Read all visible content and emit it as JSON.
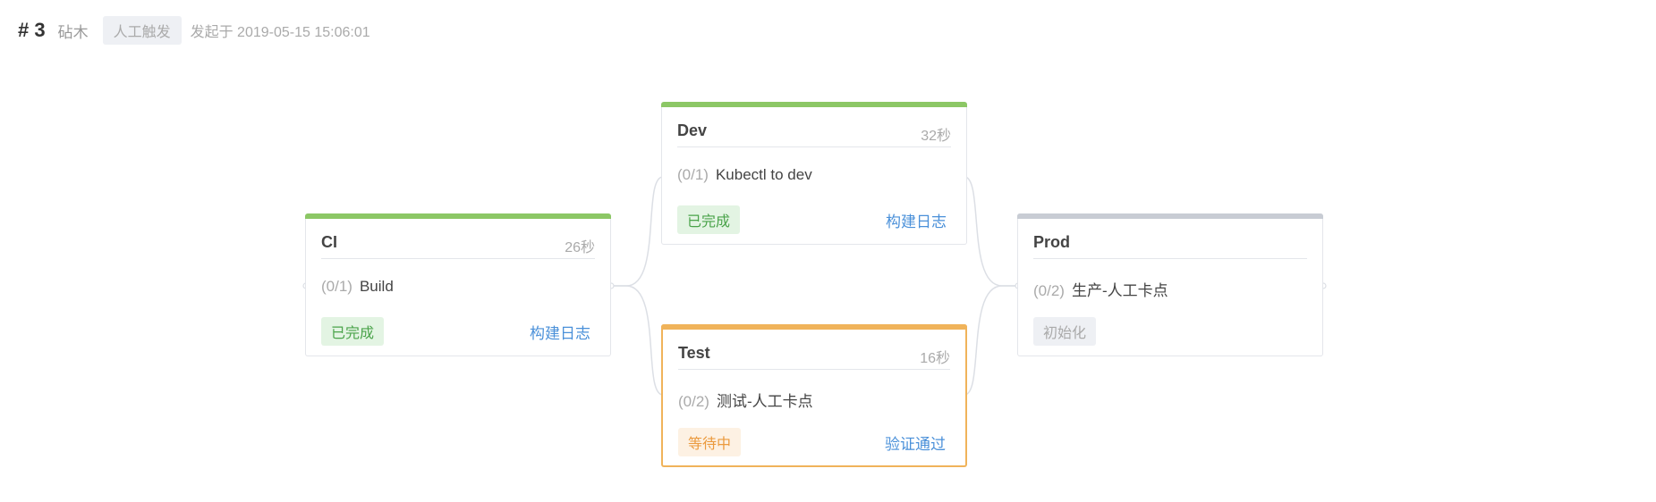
{
  "header": {
    "run_number": "# 3",
    "author": "砧木",
    "trigger_badge": "人工触发",
    "started": "发起于 2019-05-15 15:06:01"
  },
  "colors": {
    "success": "#8cc765",
    "waiting": "#f0b35a",
    "pending": "#c8ccd4",
    "link": "#4a90d9"
  },
  "stages": {
    "ci": {
      "title": "CI",
      "time": "26秒",
      "job_count": "(0/1)",
      "job_name": "Build",
      "status": "已完成",
      "action": "构建日志"
    },
    "dev": {
      "title": "Dev",
      "time": "32秒",
      "job_count": "(0/1)",
      "job_name": "Kubectl to dev",
      "status": "已完成",
      "action": "构建日志"
    },
    "test": {
      "title": "Test",
      "time": "16秒",
      "job_count": "(0/2)",
      "job_name": "测试-人工卡点",
      "status": "等待中",
      "action": "验证通过"
    },
    "prod": {
      "title": "Prod",
      "job_count": "(0/2)",
      "job_name": "生产-人工卡点",
      "status": "初始化"
    }
  }
}
